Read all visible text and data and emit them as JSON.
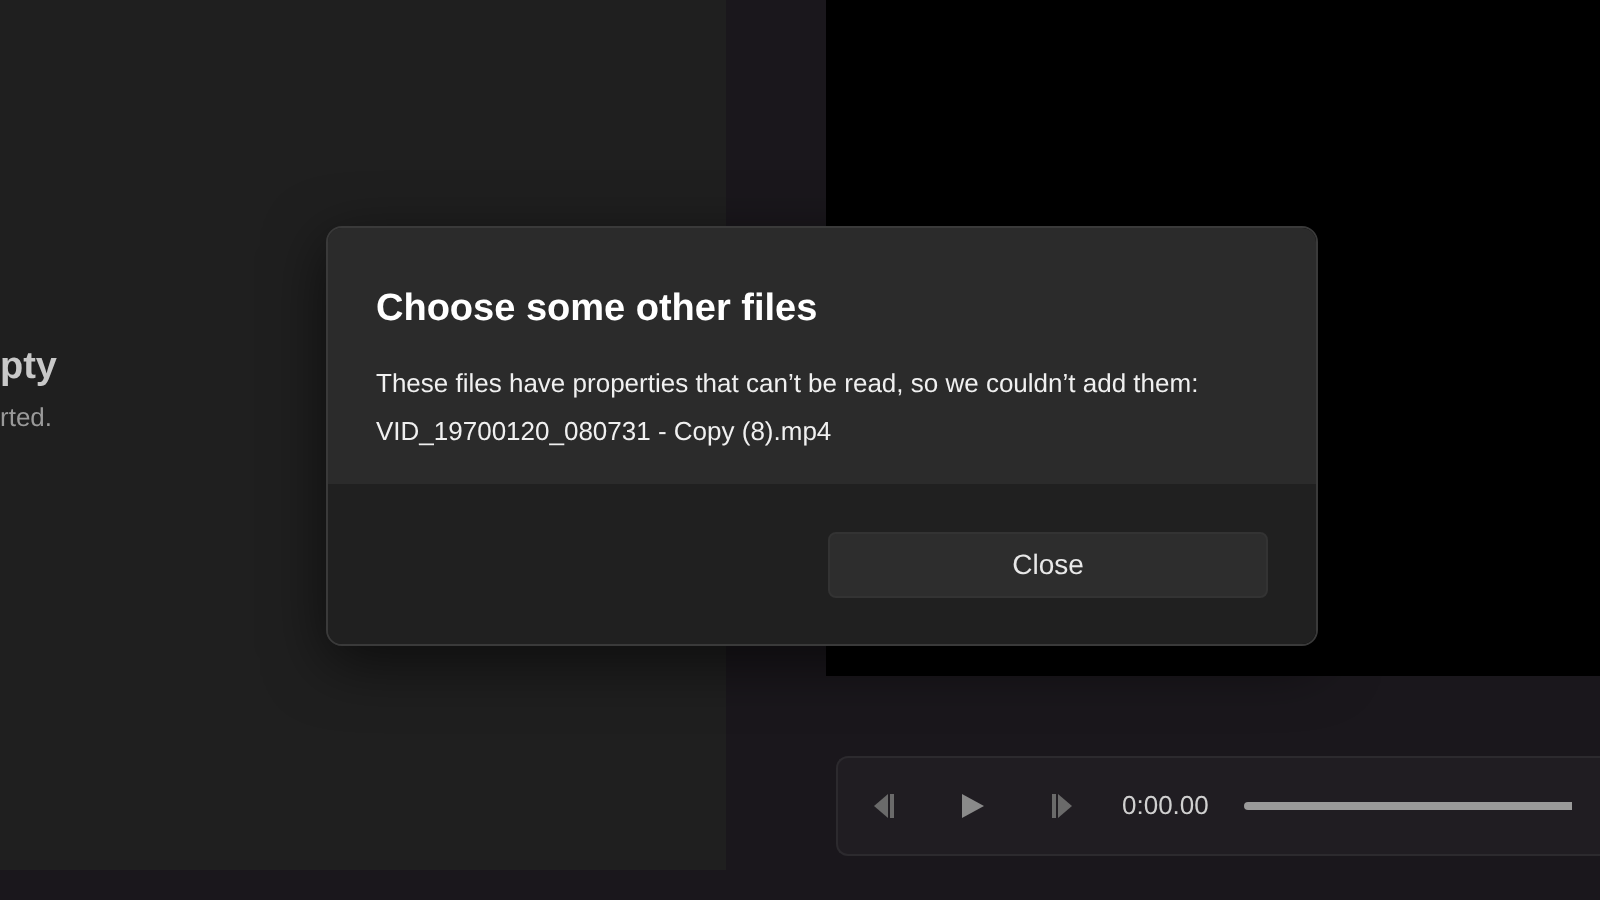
{
  "left_panel": {
    "heading": "pty",
    "subtext": "rted."
  },
  "player": {
    "time": "0:00.00"
  },
  "dialog": {
    "title": "Choose some other files",
    "message": "These files have properties that can’t be read, so we couldn’t add them:",
    "file": "VID_19700120_080731 - Copy (8).mp4",
    "buttons": [
      "Close"
    ]
  }
}
